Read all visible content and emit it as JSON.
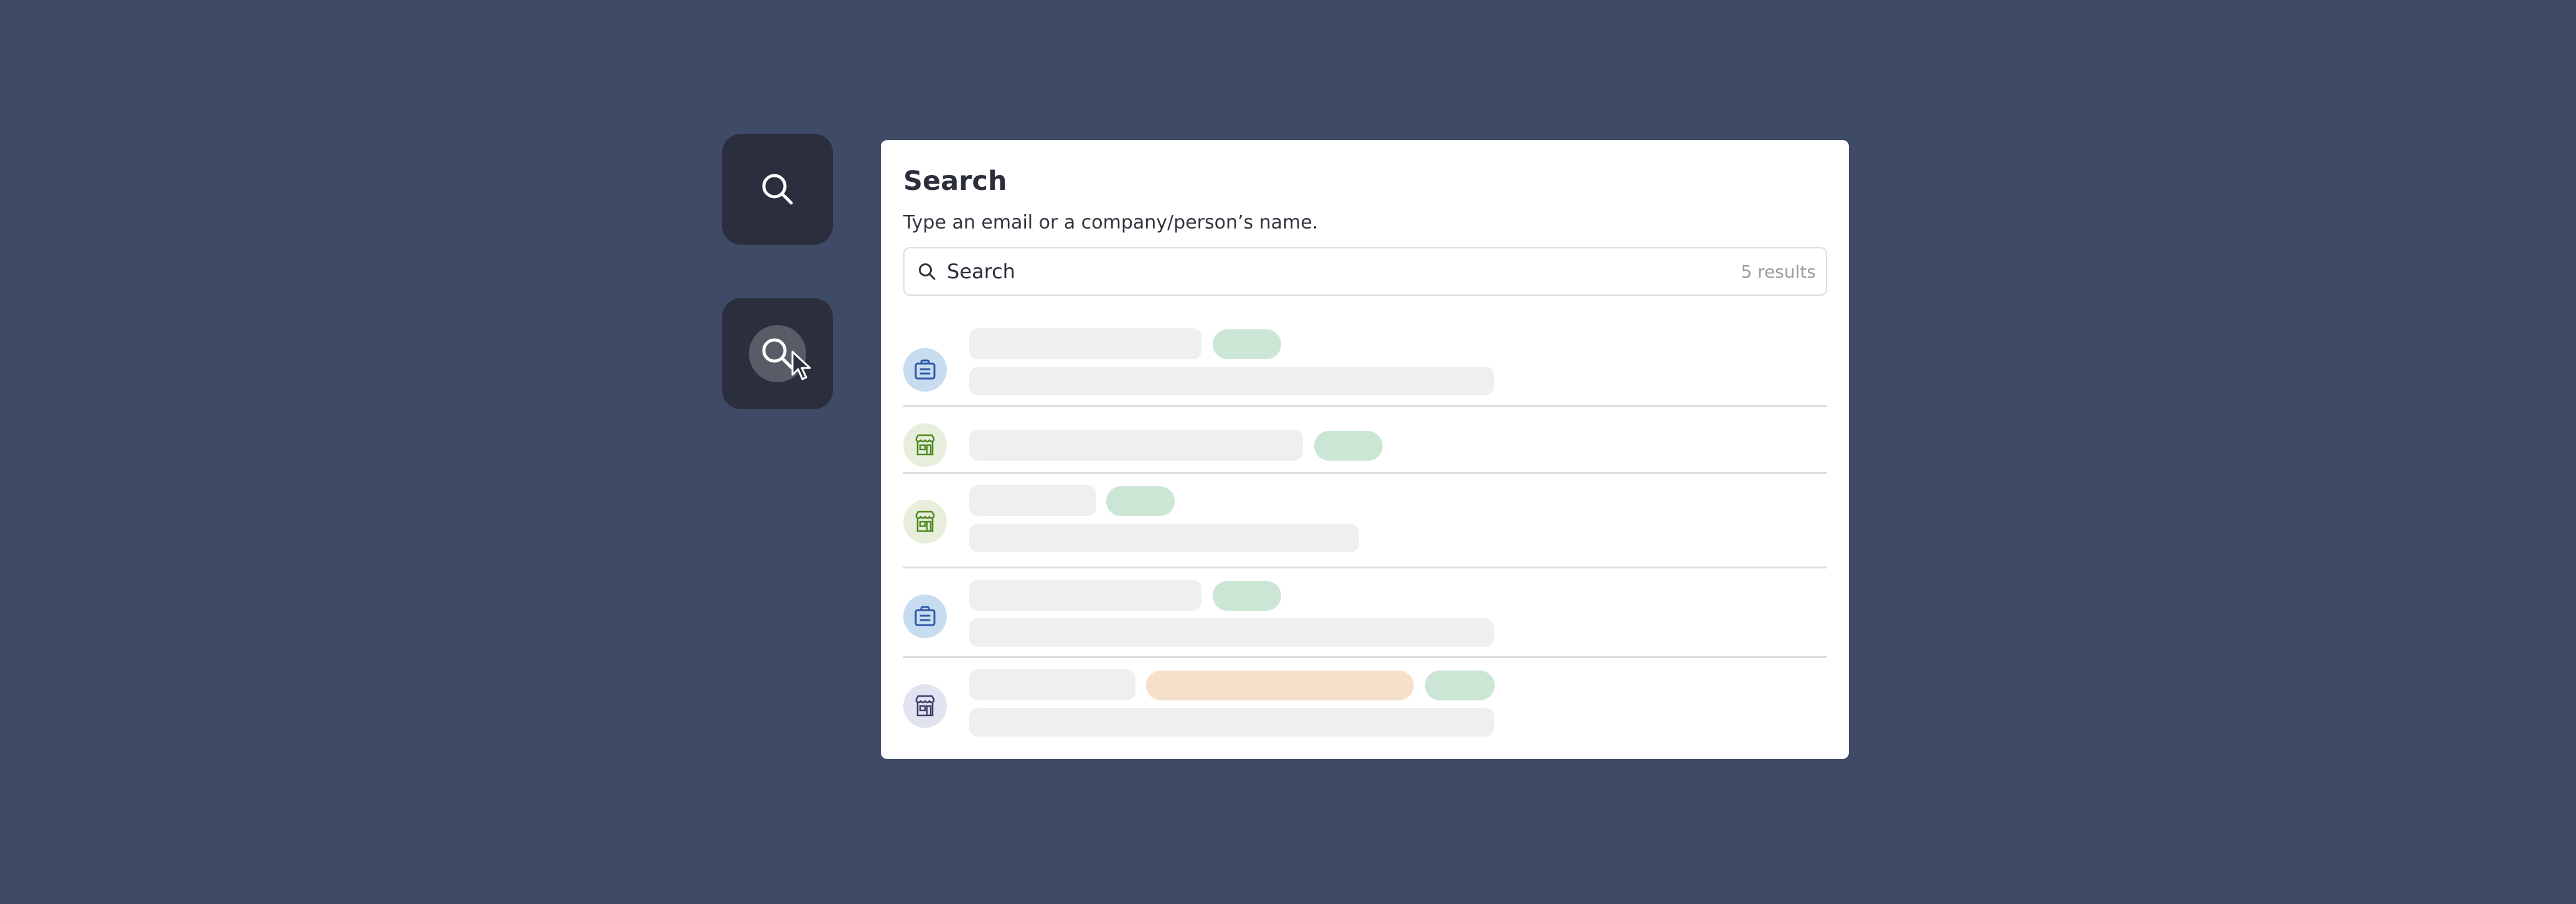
{
  "panel": {
    "title": "Search",
    "subtitle": "Type an email or a company/person’s name.",
    "search": {
      "placeholder": "Search",
      "value": "",
      "results_count": "5 results"
    }
  },
  "tiles": [
    {
      "icon": "search-icon",
      "state": "default"
    },
    {
      "icon": "search-icon",
      "state": "hover"
    }
  ],
  "results": [
    {
      "icon": "briefcase-icon",
      "avatar_color": "#c7ddef"
    },
    {
      "icon": "storefront-icon",
      "avatar_color": "#e7efdc"
    },
    {
      "icon": "storefront-icon",
      "avatar_color": "#e7efdc"
    },
    {
      "icon": "briefcase-icon",
      "avatar_color": "#c7ddef"
    },
    {
      "icon": "storefront-icon",
      "avatar_color": "#e2e3f0"
    }
  ],
  "colors": {
    "background": "#3f4a66",
    "tile": "#2b2f3d",
    "panel": "#ffffff",
    "skeleton": "#efefef",
    "tag_green": "#cce6d5",
    "tag_orange": "#f6e0cc",
    "briefcase_icon": "#2f5aa8",
    "storefront_icon_green": "#4f8a1e",
    "storefront_icon_dark": "#3a3f6b"
  }
}
